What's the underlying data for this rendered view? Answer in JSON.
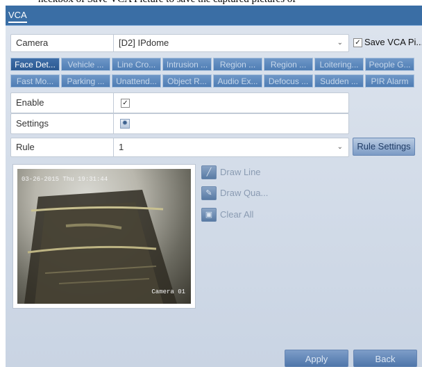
{
  "instruction_snippet": "heckbox of Save VCA Picture to save the captured pictures of",
  "title_tab": "VCA",
  "camera": {
    "label": "Camera",
    "value": "[D2] IPdome"
  },
  "save_vca": {
    "label": "Save VCA Pi...",
    "checked": true
  },
  "function_tabs": [
    [
      "Face Det...",
      "Vehicle ...",
      "Line Cro...",
      "Intrusion ...",
      "Region ...",
      "Region ...",
      "Loitering...",
      "People G..."
    ],
    [
      "Fast Mo...",
      "Parking ...",
      "Unattend...",
      "Object R...",
      "Audio Ex...",
      "Defocus ...",
      "Sudden ...",
      "PIR Alarm"
    ]
  ],
  "enable": {
    "label": "Enable",
    "checked": true
  },
  "settings": {
    "label": "Settings",
    "icon": "gear-icon"
  },
  "rule": {
    "label": "Rule",
    "value": "1",
    "button": "Rule Settings"
  },
  "preview": {
    "timestamp": "03-26-2015 Thu 19:31:44",
    "camera_name": "Camera 01"
  },
  "tools": {
    "draw_line": "Draw Line",
    "draw_quad": "Draw Qua...",
    "clear_all": "Clear All"
  },
  "buttons": {
    "apply": "Apply",
    "back": "Back"
  }
}
